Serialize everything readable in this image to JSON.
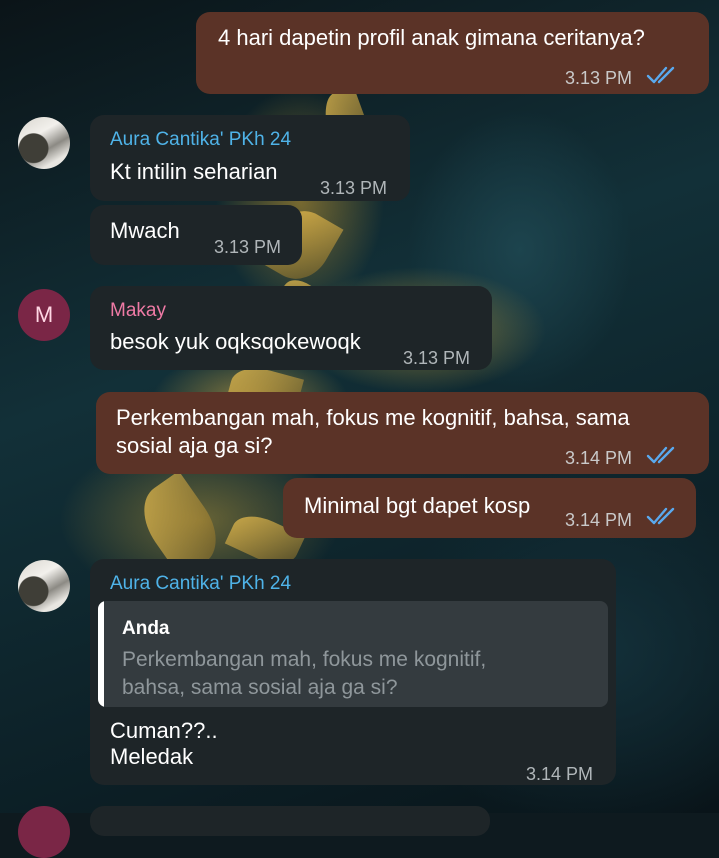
{
  "colors": {
    "outgoing_bubble": "#5b3327",
    "incoming_bubble": "#1e2528",
    "sender_blue": "#4fb3e8",
    "sender_pink": "#ef7aa5",
    "read_ticks": "#5aa9ee"
  },
  "messages": [
    {
      "direction": "outgoing",
      "text": "4 hari dapetin profil anak gimana ceritanya?",
      "time": "3.13 PM",
      "status": "read"
    },
    {
      "direction": "incoming",
      "sender": "Aura Cantika' PKh 24",
      "text": "Kt intilin seharian",
      "time": "3.13 PM"
    },
    {
      "direction": "incoming",
      "text": "Mwach",
      "time": "3.13 PM"
    },
    {
      "direction": "incoming",
      "sender": "Makay",
      "avatar_letter": "M",
      "text": "besok yuk oqksqokewoqk",
      "time": "3.13 PM"
    },
    {
      "direction": "outgoing",
      "text_line1": "Perkembangan mah, fokus me kognitif, bahsa, sama",
      "text_line2": "sosial aja ga si?",
      "time": "3.14 PM",
      "status": "read"
    },
    {
      "direction": "outgoing",
      "text": "Minimal bgt dapet kosp",
      "time": "3.14 PM",
      "status": "read"
    },
    {
      "direction": "incoming",
      "sender": "Aura Cantika' PKh 24",
      "reply": {
        "author": "Anda",
        "line1": "Perkembangan mah, fokus me kognitif,",
        "line2": "bahsa, sama sosial aja ga si?"
      },
      "text_line1": "Cuman??..",
      "text_line2": "Meledak",
      "time": "3.14 PM"
    }
  ]
}
